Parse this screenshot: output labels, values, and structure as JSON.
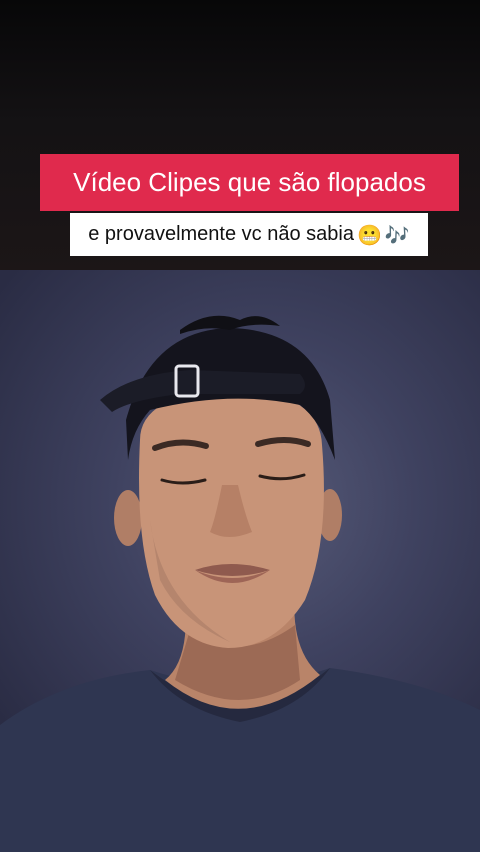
{
  "video": {
    "title": "Vídeo Clipes que são flopados",
    "subtitle": "e provavelmente vc não sabia",
    "subtitle_emojis": [
      "😬",
      "🎶"
    ]
  },
  "colors": {
    "title_background": "#e02a4d",
    "title_text": "#ffffff",
    "subtitle_background": "#ffffff",
    "subtitle_text": "#111111",
    "backdrop": "#3f4260"
  },
  "icons": {
    "face": "grimacing-face-icon",
    "music": "musical-notes-icon"
  }
}
